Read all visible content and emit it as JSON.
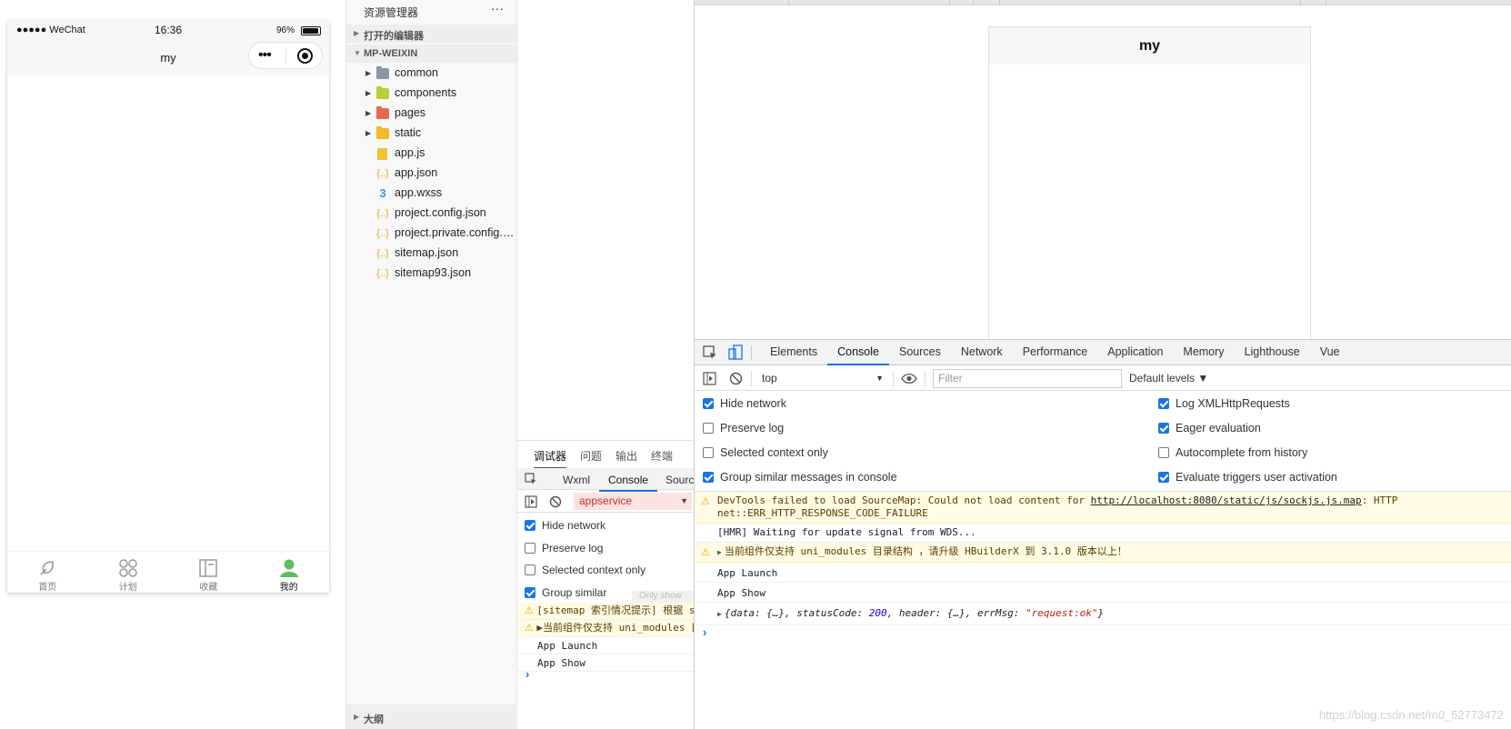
{
  "phone": {
    "carrier": "●●●●● WeChat",
    "time": "16:36",
    "battery_pct": "96%",
    "battery_level": 0.96,
    "nav_title": "my",
    "capsule_more": "•••",
    "tabs": [
      {
        "label": "首页",
        "icon": "leaf-icon",
        "active": false
      },
      {
        "label": "计划",
        "icon": "grid-icon",
        "active": false
      },
      {
        "label": "收藏",
        "icon": "book-icon",
        "active": false
      },
      {
        "label": "我的",
        "icon": "person-icon",
        "active": true
      }
    ],
    "colors": {
      "active": "#5ac15a",
      "inactive": "#9a9a9a"
    }
  },
  "explorer": {
    "title": "资源管理器",
    "more": "···",
    "open_editors": "打开的编辑器",
    "project": "MP-WEIXIN",
    "outline": "大纲",
    "items": [
      {
        "name": "common",
        "type": "folder",
        "color": "#8797a8"
      },
      {
        "name": "components",
        "type": "folder",
        "color": "#b6cf3a"
      },
      {
        "name": "pages",
        "type": "folder",
        "color": "#e8694a"
      },
      {
        "name": "static",
        "type": "folder",
        "color": "#f2b928"
      },
      {
        "name": "app.js",
        "type": "js"
      },
      {
        "name": "app.json",
        "type": "json"
      },
      {
        "name": "app.wxss",
        "type": "css"
      },
      {
        "name": "project.config.json",
        "type": "json"
      },
      {
        "name": "project.private.config.json",
        "type": "json"
      },
      {
        "name": "sitemap.json",
        "type": "json"
      },
      {
        "name": "sitemap93.json",
        "type": "json"
      }
    ]
  },
  "left_debugger": {
    "tabs": [
      "调试器",
      "问题",
      "输出",
      "终端"
    ],
    "subtabs": [
      "Wxml",
      "Console",
      "Sources"
    ],
    "context": "appservice",
    "options": [
      {
        "label": "Hide network",
        "checked": true
      },
      {
        "label": "Preserve log",
        "checked": false
      },
      {
        "label": "Selected context only",
        "checked": false
      },
      {
        "label": "Group similar",
        "checked": true
      }
    ],
    "overlay_hint": "Only show",
    "messages": [
      {
        "text": "[sitemap 索引情况提示] 根据 sitemap",
        "warn": true
      },
      {
        "text": "▶当前组件仅支持 uni_modules 目录结构",
        "warn": true
      },
      {
        "text": "App Launch",
        "warn": false
      },
      {
        "text": "App Show",
        "warn": false
      }
    ],
    "prompt": "›"
  },
  "preview": {
    "title": "my"
  },
  "devtools": {
    "tabs": [
      "Elements",
      "Console",
      "Sources",
      "Network",
      "Performance",
      "Application",
      "Memory",
      "Lighthouse",
      "Vue"
    ],
    "active_tab": "Console",
    "context": "top",
    "filter_placeholder": "Filter",
    "levels": "Default levels ▼",
    "settings_left": [
      {
        "label": "Hide network",
        "checked": true
      },
      {
        "label": "Preserve log",
        "checked": false
      },
      {
        "label": "Selected context only",
        "checked": false
      },
      {
        "label": "Group similar messages in console",
        "checked": true
      }
    ],
    "settings_right": [
      {
        "label": "Log XMLHttpRequests",
        "checked": true
      },
      {
        "label": "Eager evaluation",
        "checked": true
      },
      {
        "label": "Autocomplete from history",
        "checked": false
      },
      {
        "label": "Evaluate triggers user activation",
        "checked": true
      }
    ],
    "log": {
      "sourcemap_prefix": "DevTools failed to load SourceMap: Could not load content for ",
      "sourcemap_url": "http://localhost:8080/static/js/sockjs.js.map",
      "sourcemap_suffix": ": HTTP",
      "sourcemap_line2": "net::ERR_HTTP_RESPONSE_CODE_FAILURE",
      "hmr": "[HMR] Waiting for update signal from WDS...",
      "uni_warning": "当前组件仅支持 uni_modules 目录结构 ，请升级 HBuilderX 到 3.1.0 版本以上！",
      "app_launch": "App Launch",
      "app_show": "App Show",
      "obj_a": "{data: {…}, statusCode: ",
      "obj_code": "200",
      "obj_b": ", header: {…}, errMsg: ",
      "obj_msg": "\"request:ok\"",
      "obj_c": "}",
      "prompt": "›"
    }
  },
  "watermark": "https://blog.csdn.net/m0_52773472"
}
